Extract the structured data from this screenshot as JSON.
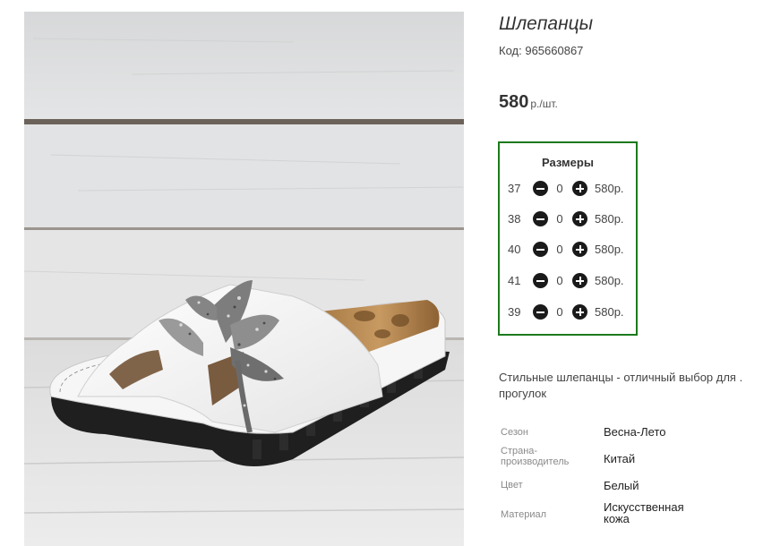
{
  "product": {
    "title": "Шлепанцы",
    "code_label": "Код:",
    "code_value": "965660867",
    "price_value": "580",
    "price_unit": "р./шт."
  },
  "sizes": {
    "title": "Размеры",
    "rows": [
      {
        "size": "37",
        "qty": "0",
        "price": "580р."
      },
      {
        "size": "38",
        "qty": "0",
        "price": "580р."
      },
      {
        "size": "40",
        "qty": "0",
        "price": "580р."
      },
      {
        "size": "41",
        "qty": "0",
        "price": "580р."
      },
      {
        "size": "39",
        "qty": "0",
        "price": "580р."
      }
    ]
  },
  "description": {
    "line1": "Стильные шлепанцы - отличный выбор для .",
    "line2": "прогулок"
  },
  "attributes": [
    {
      "key": "Сезон",
      "value": "Весна-Лето"
    },
    {
      "key": "Страна-производитель",
      "key_line1": "Страна-",
      "key_line2": "производитель",
      "value": "Китай"
    },
    {
      "key": "Цвет",
      "value": "Белый"
    },
    {
      "key": "Материал",
      "value": "Искусственная кожа",
      "value_line1": "Искусственная",
      "value_line2": "кожа"
    }
  ],
  "icons": {
    "decrease": "minus-circle-icon",
    "increase": "plus-circle-icon"
  },
  "colors": {
    "sizes_border": "#1c7a1c",
    "button": "#1a1a1a"
  }
}
